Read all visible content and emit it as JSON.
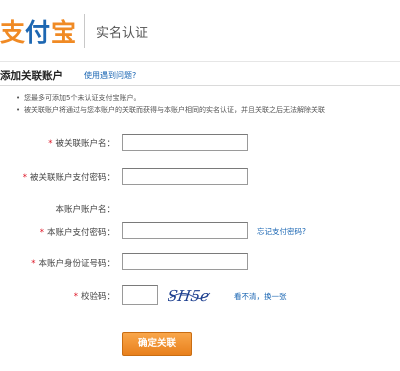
{
  "header": {
    "logo_text": "支付宝",
    "title": "实名认证"
  },
  "section": {
    "title": "添加关联账户",
    "help_link": "使用遇到问题?"
  },
  "notes": [
    "您最多可添加5个未认证支付宝账户。",
    "被关联账户将通过与您本账户的关联而获得与本账户相同的实名认证，并且关联之后无法解除关联"
  ],
  "form": {
    "linked_account": {
      "label": "被关联账户名：",
      "value": "",
      "placeholder": ""
    },
    "linked_password": {
      "label": "被关联账户支付密码：",
      "value": "",
      "placeholder": ""
    },
    "this_account": {
      "label": "本账户账户名：",
      "value": ""
    },
    "this_password": {
      "label": "本账户支付密码：",
      "value": "",
      "placeholder": "",
      "link": "忘记支付密码?"
    },
    "id_number": {
      "label": "本账户身份证号码：",
      "value": "",
      "placeholder": ""
    },
    "captcha": {
      "label": "校验码：",
      "value": "",
      "placeholder": "",
      "image_text": "SH5e",
      "refresh_link": "看不清，换一张"
    },
    "required_mark": "*"
  },
  "actions": {
    "confirm_label": "确定关联"
  },
  "colors": {
    "accent": "#f08a24",
    "link": "#1a66b3",
    "required": "#dd1122",
    "logo_orange": "#f08a24",
    "logo_blue": "#1d67b2"
  },
  "icons": {
    "logo": "alipay-logo",
    "captcha": "captcha-image"
  }
}
